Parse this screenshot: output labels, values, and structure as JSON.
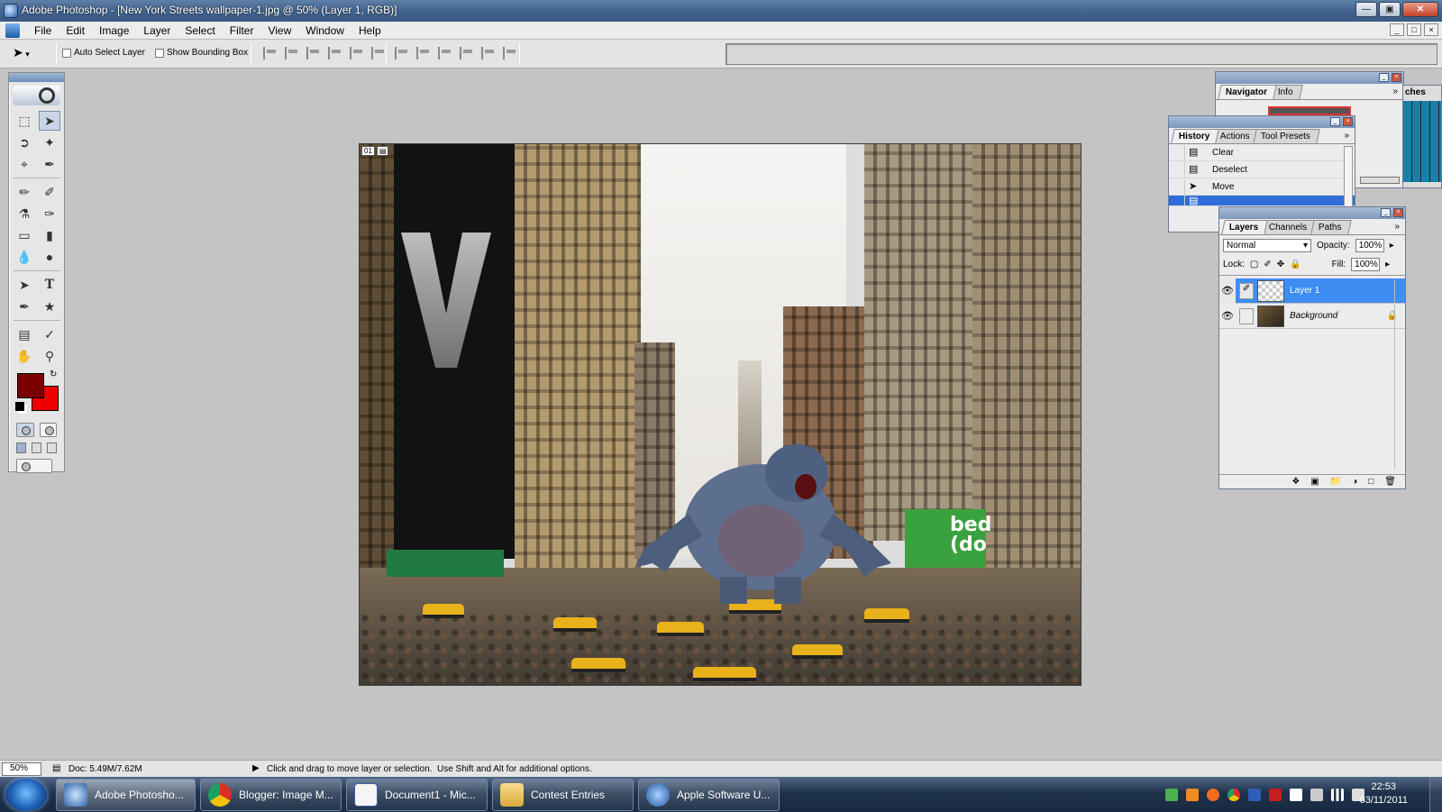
{
  "window": {
    "title": "Adobe Photoshop - [New York Streets wallpaper-1.jpg @ 50% (Layer 1, RGB)]",
    "controls": [
      "minimize",
      "maximize",
      "close"
    ]
  },
  "menu": {
    "items": [
      "File",
      "Edit",
      "Image",
      "Layer",
      "Select",
      "Filter",
      "View",
      "Window",
      "Help"
    ]
  },
  "options_bar": {
    "tool_icon": "move-tool-icon",
    "auto_select_label": "Auto Select Layer",
    "show_bounding_box_label": "Show Bounding Box"
  },
  "toolbox": {
    "tools": [
      "rect-marquee",
      "move",
      "lasso",
      "magic-wand",
      "crop",
      "slice",
      "healing-brush",
      "brush",
      "clone-stamp",
      "history-brush",
      "eraser",
      "gradient",
      "blur",
      "dodge",
      "path-select",
      "type",
      "pen",
      "custom-shape",
      "notes",
      "eyedropper",
      "hand",
      "zoom"
    ],
    "foreground_color": "#7a0000",
    "background_color": "#ee0000"
  },
  "document": {
    "tag": "01",
    "billboard_text": "bed\n(do"
  },
  "navigator": {
    "tabs": [
      "Navigator",
      "Info"
    ],
    "extra_tab": "ches"
  },
  "history": {
    "tabs": [
      "History",
      "Actions",
      "Tool Presets"
    ],
    "items": [
      {
        "label": "Clear",
        "icon": "history-state-icon"
      },
      {
        "label": "Deselect",
        "icon": "history-state-icon"
      },
      {
        "label": "Move",
        "icon": "move-state-icon"
      }
    ]
  },
  "layers": {
    "tabs": [
      "Layers",
      "Channels",
      "Paths"
    ],
    "blend_mode": "Normal",
    "opacity_label": "Opacity:",
    "opacity_value": "100%",
    "lock_label": "Lock:",
    "fill_label": "Fill:",
    "fill_value": "100%",
    "rows": [
      {
        "name": "Layer 1",
        "selected": true
      },
      {
        "name": "Background",
        "selected": false,
        "locked": true
      }
    ]
  },
  "status": {
    "zoom": "50%",
    "doc_size": "Doc: 5.49M/7.62M",
    "hint": "Click and drag to move layer or selection.  Use Shift and Alt for additional options."
  },
  "taskbar": {
    "buttons": [
      {
        "label": "Adobe Photosho...",
        "icon": "photoshop-icon",
        "active": true
      },
      {
        "label": "Blogger: Image M...",
        "icon": "chrome-icon",
        "active": false
      },
      {
        "label": "Document1 - Mic...",
        "icon": "word-icon",
        "active": false
      },
      {
        "label": "Contest Entries",
        "icon": "folder-icon",
        "active": false
      },
      {
        "label": "Apple Software U...",
        "icon": "apple-update-icon",
        "active": false
      }
    ],
    "time": "22:53",
    "date": "03/11/2011"
  }
}
